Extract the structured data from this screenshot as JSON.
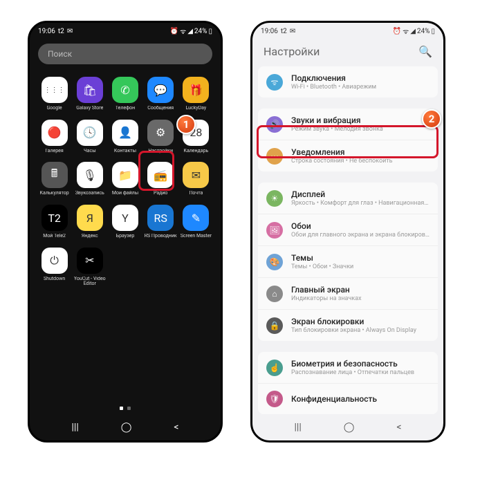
{
  "status": {
    "time": "19:06",
    "carrier": "t2",
    "battery": "24%"
  },
  "search": {
    "placeholder": "Поиск"
  },
  "apps": [
    {
      "label": "Google",
      "bg": "#fff",
      "glyph": "⋮⋮⋮"
    },
    {
      "label": "Galaxy Store",
      "bg": "#6b3fd6",
      "glyph": "🛍"
    },
    {
      "label": "Телефон",
      "bg": "#35c75a",
      "glyph": "✆"
    },
    {
      "label": "Сообщения",
      "bg": "#1e88ff",
      "glyph": "💬"
    },
    {
      "label": "LuckyDay",
      "bg": "#f2b21e",
      "glyph": "🎁"
    },
    {
      "label": "Галерея",
      "bg": "#fff",
      "glyph": "🔴"
    },
    {
      "label": "Часы",
      "bg": "#fff",
      "glyph": "🕓"
    },
    {
      "label": "Контакты",
      "bg": "#fff",
      "glyph": "👤"
    },
    {
      "label": "Настройки",
      "bg": "#696969",
      "glyph": "⚙"
    },
    {
      "label": "Календарь",
      "bg": "#fff",
      "glyph": "28"
    },
    {
      "label": "Калькулятор",
      "bg": "#555",
      "glyph": "🖩"
    },
    {
      "label": "Звукозапись",
      "bg": "#fff",
      "glyph": "🎙"
    },
    {
      "label": "Мои файлы",
      "bg": "#fff",
      "glyph": "📁"
    },
    {
      "label": "Радио",
      "bg": "#fff",
      "glyph": "📻"
    },
    {
      "label": "Почта",
      "bg": "#f7c948",
      "glyph": "✉"
    },
    {
      "label": "Мой Tele2",
      "bg": "#000",
      "glyph": "T2"
    },
    {
      "label": "Яндекс",
      "bg": "#ffdb4d",
      "glyph": "Я"
    },
    {
      "label": "Браузер",
      "bg": "#fff",
      "glyph": "Y"
    },
    {
      "label": "RS Проводник",
      "bg": "#1976d2",
      "glyph": "RS"
    },
    {
      "label": "Screen Master",
      "bg": "#1e88ff",
      "glyph": "✎"
    },
    {
      "label": "Shutdown",
      "bg": "#fff",
      "glyph": "⏻"
    },
    {
      "label": "YouCut - Video Editor",
      "bg": "#000",
      "glyph": "✂"
    }
  ],
  "settings": {
    "title": "Настройки",
    "items": [
      {
        "name": "Подключения",
        "sub": "Wi-Fi • Bluetooth • Авиарежим",
        "color": "#4aa8d8",
        "glyph": "ᯤ"
      },
      {
        "name": "Звуки и вибрация",
        "sub": "Режим звука • Мелодия звонка",
        "color": "#8a6fd4",
        "glyph": "🔊"
      },
      {
        "name": "Уведомления",
        "sub": "Строка состояния • Не беспокоить",
        "color": "#e0a24b",
        "glyph": "⋯"
      },
      {
        "name": "Дисплей",
        "sub": "Яркость • Комфорт для глаз • Навигационная панель",
        "color": "#7bb661",
        "glyph": "☀"
      },
      {
        "name": "Обои",
        "sub": "Обои для главного экрана и экрана блокировки",
        "color": "#d66fa3",
        "glyph": "🖼"
      },
      {
        "name": "Темы",
        "sub": "Темы • Обои • Значки",
        "color": "#6fa3d6",
        "glyph": "🎨"
      },
      {
        "name": "Главный экран",
        "sub": "Индикаторы на значках",
        "color": "#8a8a8a",
        "glyph": "⌂"
      },
      {
        "name": "Экран блокировки",
        "sub": "Тип блокировки экрана • Always On Display",
        "color": "#5a5a5a",
        "glyph": "🔒"
      },
      {
        "name": "Биометрия и безопасность",
        "sub": "Распознавание лица • Отпечатки пальцев",
        "color": "#4a9e8f",
        "glyph": "☝"
      },
      {
        "name": "Конфиденциальность",
        "sub": "",
        "color": "#c45a8a",
        "glyph": "🛡"
      }
    ]
  },
  "callouts": {
    "one": "1",
    "two": "2"
  }
}
